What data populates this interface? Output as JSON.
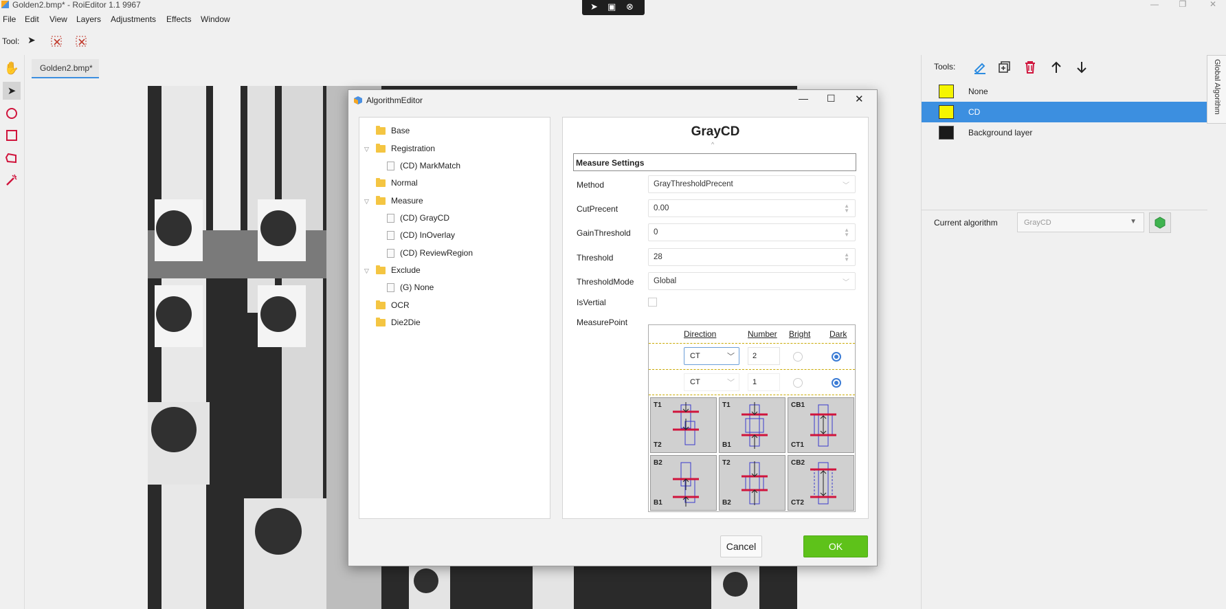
{
  "window": {
    "title": "Golden2.bmp* - RoiEditor 1.1 9967"
  },
  "menu": [
    "File",
    "Edit",
    "View",
    "Layers",
    "Adjustments",
    "Effects",
    "Window"
  ],
  "toolbar": {
    "tool_label": "Tool:"
  },
  "document_tab": "Golden2.bmp*",
  "right_panel": {
    "tools_label": "Tools:",
    "layers": [
      {
        "name": "None",
        "color": "#f5f500",
        "selected": false
      },
      {
        "name": "CD",
        "color": "#f5f500",
        "selected": true
      },
      {
        "name": "Background layer",
        "color": "#000000",
        "selected": false
      }
    ],
    "current_algorithm_label": "Current algorithm",
    "current_algorithm_value": "GrayCD",
    "side_tab": "Global Algorithm"
  },
  "dialog": {
    "title": "AlgorithmEditor",
    "tree": [
      {
        "label": "Base",
        "type": "folder",
        "level": 0
      },
      {
        "label": "Registration",
        "type": "folder",
        "level": 0,
        "expanded": true
      },
      {
        "label": "(CD) MarkMatch",
        "type": "file",
        "level": 1
      },
      {
        "label": "Normal",
        "type": "folder",
        "level": 0
      },
      {
        "label": "Measure",
        "type": "folder",
        "level": 0,
        "expanded": true
      },
      {
        "label": "(CD) GrayCD",
        "type": "file",
        "level": 1
      },
      {
        "label": "(CD) InOverlay",
        "type": "file",
        "level": 1
      },
      {
        "label": "(CD) ReviewRegion",
        "type": "file",
        "level": 1
      },
      {
        "label": "Exclude",
        "type": "folder",
        "level": 0,
        "expanded": true
      },
      {
        "label": "(G) None",
        "type": "file",
        "level": 1
      },
      {
        "label": "OCR",
        "type": "folder",
        "level": 0
      },
      {
        "label": "Die2Die",
        "type": "folder",
        "level": 0
      }
    ],
    "algo_title": "GrayCD",
    "section_title": "Measure Settings",
    "props": {
      "method_label": "Method",
      "method_value": "GrayThresholdPrecent",
      "cut_label": "CutPrecent",
      "cut_value": "0.00",
      "gain_label": "GainThreshold",
      "gain_value": "0",
      "threshold_label": "Threshold",
      "threshold_value": "28",
      "mode_label": "ThresholdMode",
      "mode_value": "Global",
      "isvertial_label": "IsVertial",
      "isvertial_checked": false,
      "measurepoint_label": "MeasurePoint"
    },
    "measure_table": {
      "headers": [
        "Direction",
        "Number",
        "Bright",
        "Dark"
      ],
      "rows": [
        {
          "direction": "CT",
          "number": "2",
          "selected": "Dark"
        },
        {
          "direction": "CT",
          "number": "1",
          "selected": "Dark"
        }
      ],
      "images": [
        {
          "top": "T1",
          "bottom": "T2"
        },
        {
          "top": "T1",
          "bottom": "B1"
        },
        {
          "top": "CB1",
          "bottom": "CT1"
        },
        {
          "top": "B2",
          "bottom": "B1"
        },
        {
          "top": "T2",
          "bottom": "B2"
        },
        {
          "top": "CB2",
          "bottom": "CT2"
        }
      ]
    },
    "cancel_label": "Cancel",
    "ok_label": "OK"
  },
  "colors": {
    "accent": "#3c8fe0",
    "ok_green": "#5ec21a",
    "marker_red": "#d0143c",
    "marker_blue": "#3a3acc"
  }
}
